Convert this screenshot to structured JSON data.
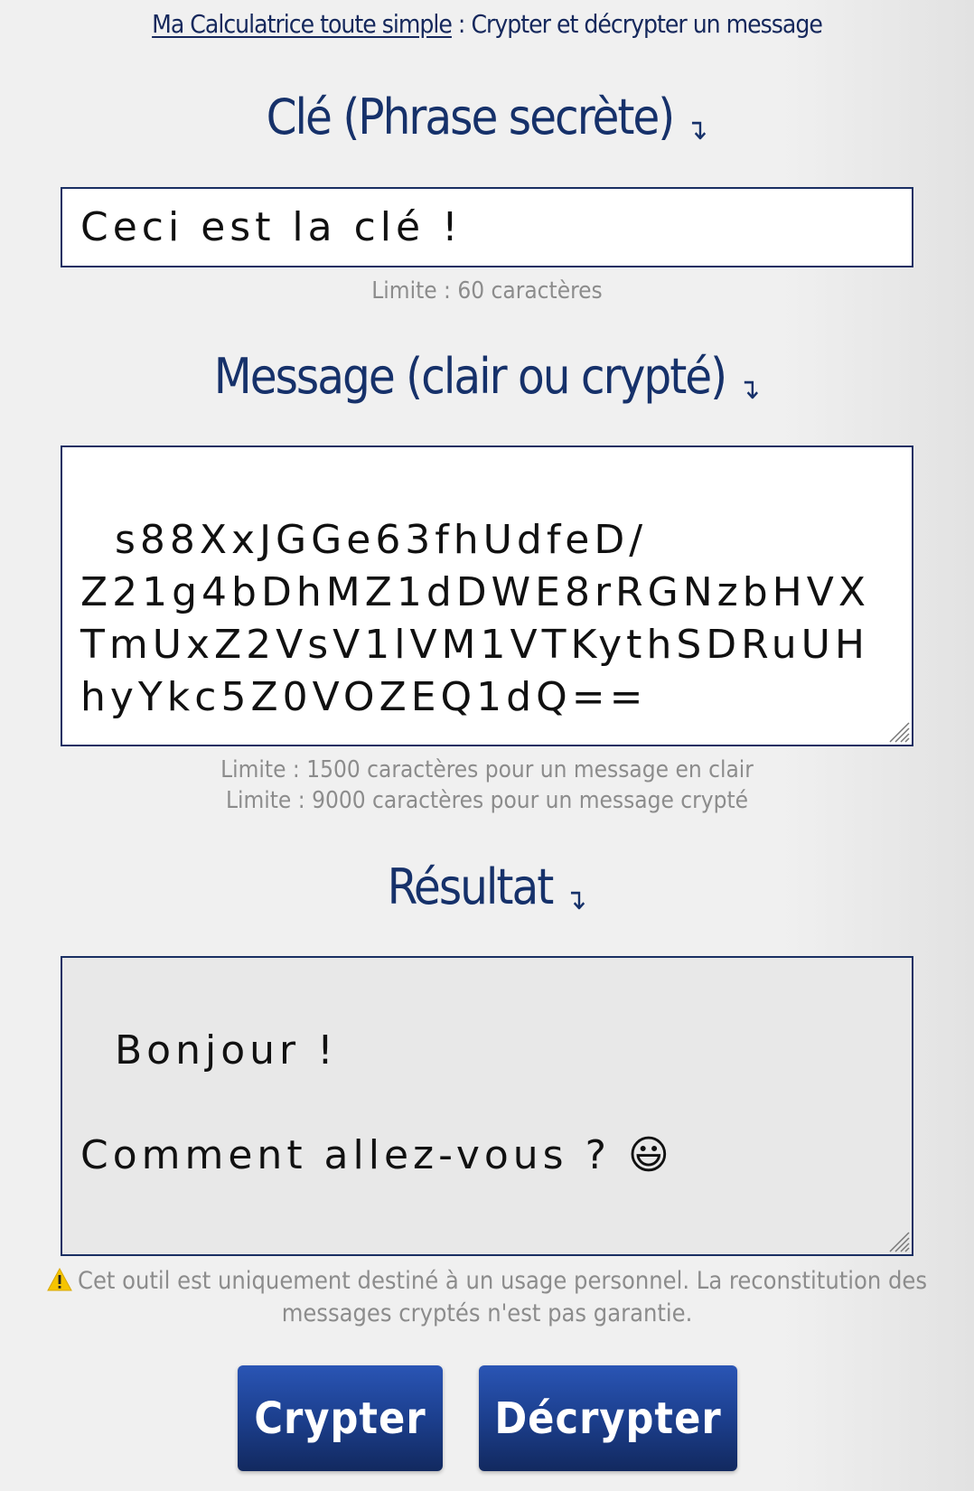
{
  "breadcrumb": {
    "link": "Ma Calculatrice toute simple",
    "separator": " : ",
    "page": "Crypter et décrypter un message"
  },
  "key_section": {
    "title": "Clé (Phrase secrète)",
    "arrow": "↴",
    "value": "Ceci est la clé !",
    "limit": "Limite : 60 caractères"
  },
  "message_section": {
    "title": "Message (clair ou crypté)",
    "arrow": "↴",
    "value": "s88XxJGGe63fhUdfeD/\nZ21g4bDhMZ1dDWE8rRGNzbHVXTmUxZ2VsV1lVM1VTKythSDRuUHhyYkc5Z0VOZEQ1dQ==",
    "limit_clear": "Limite : 1500 caractères pour un message en clair",
    "limit_crypted": "Limite : 9000 caractères pour un message crypté"
  },
  "result_section": {
    "title": "Résultat",
    "arrow": "↴",
    "value": "Bonjour !\n\nComment allez-vous ? 😃"
  },
  "warning": {
    "icon": "warning-icon",
    "text": "Cet outil est uniquement destiné à un usage personnel. La reconstitution des messages cryptés n'est pas garantie."
  },
  "buttons": {
    "crypt": "Crypter",
    "decrypt": "Décrypter"
  },
  "colors": {
    "title": "#16316a",
    "button_top": "#2a55b5",
    "button_bottom": "#12295f",
    "hint": "#8c8c8c"
  }
}
